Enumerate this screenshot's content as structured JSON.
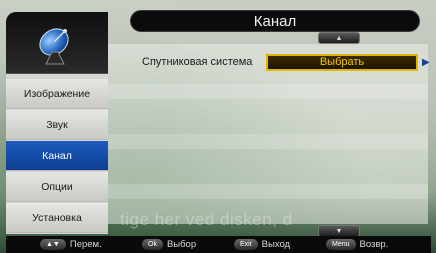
{
  "header": {
    "title": "Канал"
  },
  "sidebar": {
    "header_icon": "satellite-dish-icon",
    "items": [
      {
        "label": "Изображение",
        "active": false
      },
      {
        "label": "Звук",
        "active": false
      },
      {
        "label": "Канал",
        "active": true
      },
      {
        "label": "Опции",
        "active": false
      },
      {
        "label": "Установка",
        "active": false
      }
    ]
  },
  "main": {
    "settings": [
      {
        "label": "Спутниковая система",
        "value": "Выбрать"
      }
    ],
    "scroll_up_icon": "triangle-up-icon",
    "scroll_down_icon": "triangle-down-icon"
  },
  "background_subtitle": "tige her ved disken, d",
  "footer": {
    "hints": [
      {
        "key": "▲▼",
        "label": "Перем."
      },
      {
        "key": "Ok",
        "label": "Выбор"
      },
      {
        "key": "Exit",
        "label": "Выход"
      },
      {
        "key": "Menu",
        "label": "Возвр."
      }
    ]
  },
  "colors": {
    "active_item": "#1d5bbf",
    "value_border": "#e4b500",
    "value_text": "#f4c400"
  }
}
